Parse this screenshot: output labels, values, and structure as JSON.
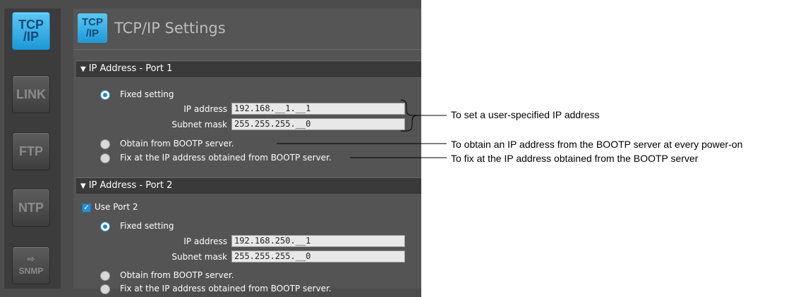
{
  "sidebar": {
    "tiles": [
      {
        "label_top": "TCP",
        "label_bottom": "/IP",
        "active": true
      },
      {
        "label": "LINK",
        "active": false
      },
      {
        "label": "FTP",
        "active": false
      },
      {
        "label": "NTP",
        "active": false
      },
      {
        "label": "SNMP",
        "active": false
      }
    ]
  },
  "header": {
    "icon_top": "TCP",
    "icon_bottom": "/IP",
    "title": "TCP/IP Settings"
  },
  "port1": {
    "section_title": "IP Address - Port 1",
    "fixed_label": "Fixed setting",
    "ip_label": "IP address",
    "ip_value": "192.168.__1.__1",
    "mask_label": "Subnet mask",
    "mask_value": "255.255.255.__0",
    "bootp_label": "Obtain from BOOTP server.",
    "fix_bootp_label": "Fix at the IP address obtained from BOOTP server.",
    "selected": "fixed"
  },
  "port2": {
    "section_title": "IP Address - Port 2",
    "use_label": "Use Port 2",
    "use_checked": true,
    "fixed_label": "Fixed setting",
    "ip_label": "IP address",
    "ip_value": "192.168.250.__1",
    "mask_label": "Subnet mask",
    "mask_value": "255.255.255.__0",
    "bootp_label": "Obtain from BOOTP server.",
    "fix_bootp_label": "Fix at the IP address obtained from BOOTP server.",
    "selected": "fixed"
  },
  "annotations": {
    "user_ip": "To set a user-specified IP address",
    "bootp_every": "To obtain an IP address from the BOOTP server at every power-on",
    "bootp_fix": "To fix at the IP address obtained from the BOOTP server"
  },
  "colors": {
    "accent": "#1e98d8",
    "panel": "#545454",
    "section": "#3a3a3a"
  }
}
